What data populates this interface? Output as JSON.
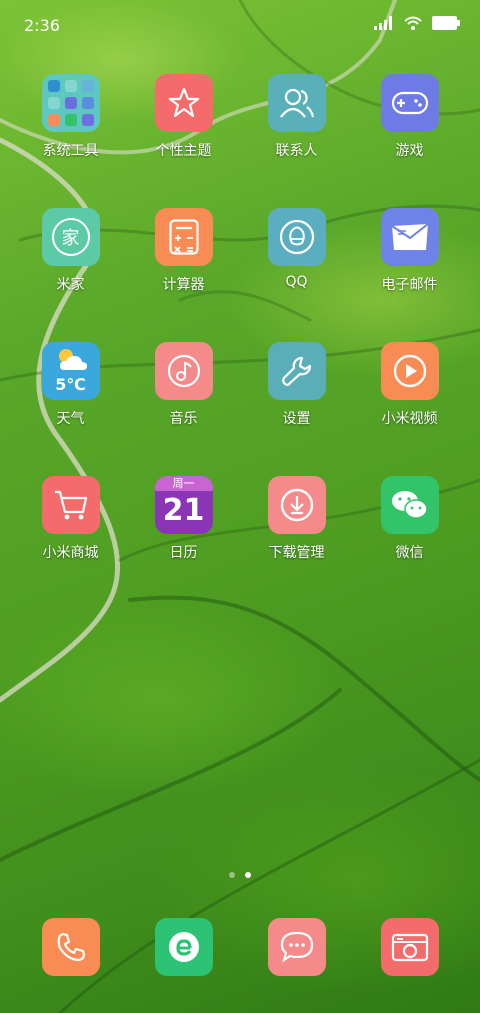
{
  "status": {
    "time": "2:36"
  },
  "apps": [
    {
      "label": "系统工具",
      "icon": "folder-icon"
    },
    {
      "label": "个性主题",
      "icon": "theme-icon"
    },
    {
      "label": "联系人",
      "icon": "contacts-icon"
    },
    {
      "label": "游戏",
      "icon": "gamepad-icon"
    },
    {
      "label": "米家",
      "icon": "mijia-icon",
      "glyph": "家"
    },
    {
      "label": "计算器",
      "icon": "calculator-icon"
    },
    {
      "label": "QQ",
      "icon": "qq-icon"
    },
    {
      "label": "电子邮件",
      "icon": "email-icon"
    },
    {
      "label": "天气",
      "icon": "weather-icon",
      "temp": "5℃"
    },
    {
      "label": "音乐",
      "icon": "music-icon"
    },
    {
      "label": "设置",
      "icon": "wrench-icon"
    },
    {
      "label": "小米视频",
      "icon": "video-icon"
    },
    {
      "label": "小米商城",
      "icon": "cart-icon"
    },
    {
      "label": "日历",
      "icon": "calendar-icon",
      "weekday": "周一",
      "day": "21"
    },
    {
      "label": "下载管理",
      "icon": "download-icon"
    },
    {
      "label": "微信",
      "icon": "wechat-icon"
    }
  ],
  "dock": [
    {
      "icon": "phone-icon"
    },
    {
      "icon": "browser-icon"
    },
    {
      "icon": "messages-icon"
    },
    {
      "icon": "camera-icon"
    }
  ],
  "colors": {
    "folder": "#5ec8c0",
    "theme": "#f56b6b",
    "contacts": "#5ab0b8",
    "games": "#6e7be6",
    "mijia": "#5cc9a7",
    "calculator": "#f98b55",
    "qq": "#5aaec0",
    "email": "#6e82e8",
    "weather": "#3aa7dd",
    "music": "#f48a8a",
    "settings": "#5aaeb8",
    "video": "#f98b55",
    "mall": "#f46b6b",
    "calendar": "#8a35b5",
    "download": "#f48a8a",
    "wechat": "#33c46a",
    "phone": "#f98b55",
    "browser": "#2cc474",
    "messages": "#f48a8a",
    "camera": "#f46b6b"
  },
  "pager": {
    "pages": 2,
    "active": 2
  }
}
